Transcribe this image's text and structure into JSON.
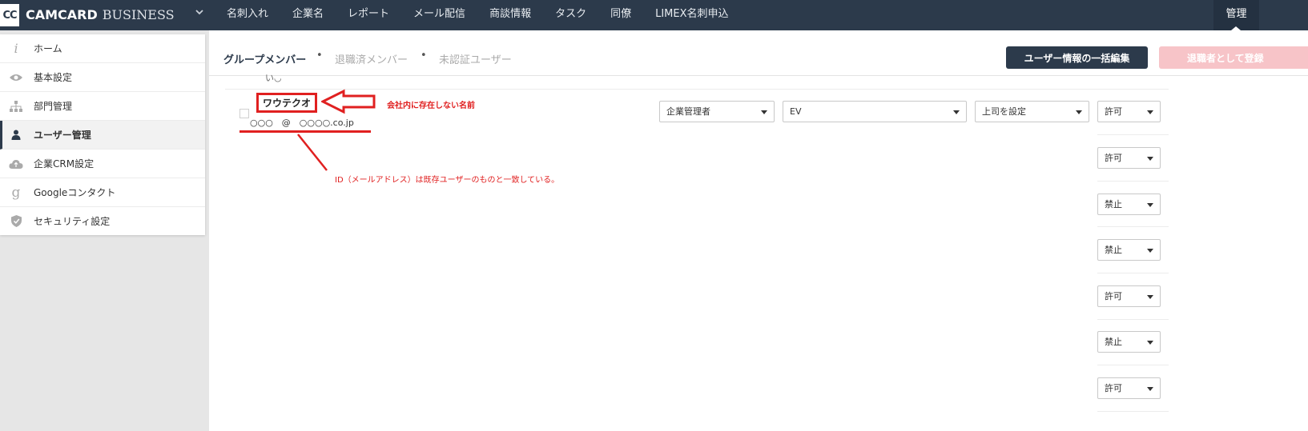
{
  "topbar": {
    "logo": "CC",
    "brand_bold": "CAMCARD",
    "brand_light": "BUSINESS",
    "nav": [
      "名刺入れ",
      "企業名",
      "レポート",
      "メール配信",
      "商談情報",
      "タスク",
      "同僚",
      "LIMEX名刺申込"
    ],
    "admin": "管理"
  },
  "sidebar": {
    "items": [
      {
        "label": "ホーム",
        "icon": "info-icon"
      },
      {
        "label": "基本設定",
        "icon": "eye-icon"
      },
      {
        "label": "部門管理",
        "icon": "org-chart-icon"
      },
      {
        "label": "ユーザー管理",
        "icon": "user-icon",
        "active": true
      },
      {
        "label": "企業CRM設定",
        "icon": "cloud-icon"
      },
      {
        "label": "Googleコンタクト",
        "icon": "google-icon"
      },
      {
        "label": "セキュリティ設定",
        "icon": "shield-icon"
      }
    ]
  },
  "tabs": [
    "グループメンバー",
    "退職済メンバー",
    "未認証ユーザー"
  ],
  "buttons": {
    "bulk_edit": "ユーザー情報の一括編集",
    "retire": "退職者として登録"
  },
  "user": {
    "name": "ワウテクオ",
    "email": "○○○　@　○○○○.co.jp",
    "role": "企業管理者",
    "department": "EV",
    "manager": "上司を設定"
  },
  "annotations": {
    "name_note": "会社内に存在しない名前",
    "id_note": "ID（メールアドレス）は既存ユーザーのものと一致している。"
  },
  "permissions": [
    "許可",
    "許可",
    "禁止",
    "禁止",
    "許可",
    "禁止",
    "許可"
  ],
  "colors": {
    "topbar": "#2c3a4b",
    "annotation_red": "#e02020",
    "retire_button": "#f7c4c8"
  }
}
